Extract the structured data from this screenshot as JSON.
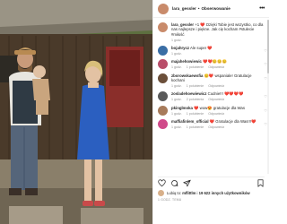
{
  "post": {
    "author": "lara_gessler",
    "follow_label": "Obserwowanie",
    "caption_user": "lara_gessler",
    "caption_text": "❤️ Dzięki Tobie jest wszystko, co dla nas najlepsze i piękne. Jak cię kocham #stulecie #miłość",
    "caption_prefix": "+1",
    "caption_age": "1 godz."
  },
  "comments": [
    {
      "user": "bojahrycz",
      "text": "Ale super ❤️",
      "age": "1 godz.",
      "likes": "",
      "reply": ""
    },
    {
      "user": "majahehowiewic",
      "text": "❤️❤️😊😊😊",
      "age": "1 godz.",
      "likes": "1 polubienie",
      "reply": "Odpowiedz"
    },
    {
      "user": "zborowskaewsfia",
      "text": "😊❤️ wspaniale! Gratulacje kochani",
      "age": "1 godz.",
      "likes": "1 polubienie",
      "reply": "Odpowiedz"
    },
    {
      "user": "zosladehoewiewicz",
      "text": "Cudnie!!! ❤️❤️❤️❤️",
      "age": "1 godz.",
      "likes": "2 polubienia",
      "reply": "Odpowiedz"
    },
    {
      "user": "pkinglmoka",
      "text": "❤️ wow😍 gratulacje dla Was",
      "age": "1 godz.",
      "likes": "1 polubienie",
      "reply": "Odpowiedz"
    },
    {
      "user": "maffiafinlem_official",
      "text": "❤️ Gratulacje dla Was!!!❤️",
      "age": "1 godz.",
      "likes": "1 polubienie",
      "reply": "Odpowiedz"
    }
  ],
  "footer": {
    "likes_prefix": "Lubią to:",
    "likes_user": "mflittlm",
    "likes_mid": "i",
    "likes_count": "19 622 innych użytkowników",
    "date": "1 GODZ. TEMU"
  },
  "colors": {
    "heart_red": "#ed4956",
    "avatar_colors": [
      "#c98b6b",
      "#3a6ea5",
      "#b94e6a",
      "#6b4f3a",
      "#5a5a5a",
      "#a77b5b",
      "#d04a8a"
    ]
  },
  "icons": [
    "heart-icon",
    "comment-icon",
    "share-icon",
    "bookmark-icon",
    "more-icon"
  ]
}
